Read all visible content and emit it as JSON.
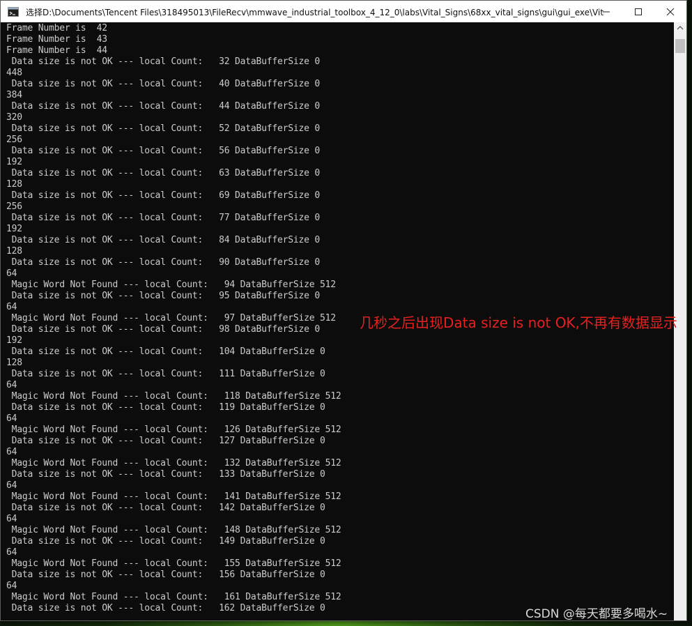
{
  "window": {
    "title": "选择D:\\Documents\\Tencent Files\\318495013\\FileRecv\\mmwave_industrial_toolbox_4_12_0\\labs\\Vital_Signs\\68xx_vital_signs\\gui\\gui_exe\\Vita...",
    "minimize_glyph": "—",
    "maximize_glyph": "☐",
    "close_glyph": "✕"
  },
  "console": {
    "lines": [
      "Frame Number is  42",
      "Frame Number is  43",
      "Frame Number is  44",
      " Data size is not OK --- local Count:   32 DataBufferSize 0",
      "448",
      " Data size is not OK --- local Count:   40 DataBufferSize 0",
      "384",
      " Data size is not OK --- local Count:   44 DataBufferSize 0",
      "320",
      " Data size is not OK --- local Count:   52 DataBufferSize 0",
      "256",
      " Data size is not OK --- local Count:   56 DataBufferSize 0",
      "192",
      " Data size is not OK --- local Count:   63 DataBufferSize 0",
      "128",
      " Data size is not OK --- local Count:   69 DataBufferSize 0",
      "256",
      " Data size is not OK --- local Count:   77 DataBufferSize 0",
      "192",
      " Data size is not OK --- local Count:   84 DataBufferSize 0",
      "128",
      " Data size is not OK --- local Count:   90 DataBufferSize 0",
      "64",
      " Magic Word Not Found --- local Count:   94 DataBufferSize 512",
      " Data size is not OK --- local Count:   95 DataBufferSize 0",
      "64",
      " Magic Word Not Found --- local Count:   97 DataBufferSize 512",
      " Data size is not OK --- local Count:   98 DataBufferSize 0",
      "192",
      " Data size is not OK --- local Count:   104 DataBufferSize 0",
      "128",
      " Data size is not OK --- local Count:   111 DataBufferSize 0",
      "64",
      " Magic Word Not Found --- local Count:   118 DataBufferSize 512",
      " Data size is not OK --- local Count:   119 DataBufferSize 0",
      "64",
      " Magic Word Not Found --- local Count:   126 DataBufferSize 512",
      " Data size is not OK --- local Count:   127 DataBufferSize 0",
      "64",
      " Magic Word Not Found --- local Count:   132 DataBufferSize 512",
      " Data size is not OK --- local Count:   133 DataBufferSize 0",
      "64",
      " Magic Word Not Found --- local Count:   141 DataBufferSize 512",
      " Data size is not OK --- local Count:   142 DataBufferSize 0",
      "64",
      " Magic Word Not Found --- local Count:   148 DataBufferSize 512",
      " Data size is not OK --- local Count:   149 DataBufferSize 0",
      "64",
      " Magic Word Not Found --- local Count:   155 DataBufferSize 512",
      " Data size is not OK --- local Count:   156 DataBufferSize 0",
      "64",
      " Magic Word Not Found --- local Count:   161 DataBufferSize 512",
      " Data size is not OK --- local Count:   162 DataBufferSize 0"
    ]
  },
  "annotation": {
    "text": "几秒之后出现Data size is not OK,不再有数据显示",
    "color": "#e8201e"
  },
  "watermark": {
    "text": "CSDN @每天都要多喝水~"
  },
  "colors": {
    "console_bg": "#0c0c0c",
    "console_text": "#cccccc",
    "titlebar_bg": "#ffffff"
  }
}
